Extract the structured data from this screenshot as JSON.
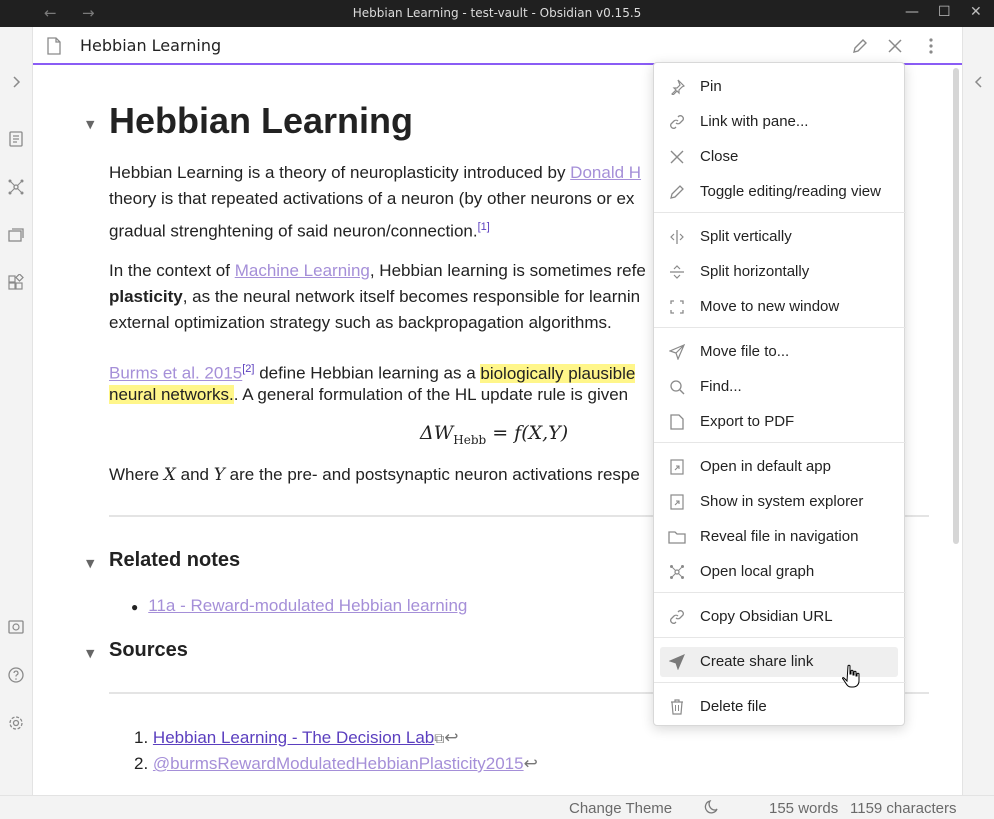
{
  "window": {
    "title": "Hebbian Learning - test-vault - Obsidian v0.15.5",
    "back": "←",
    "forward": "→",
    "minimize": "—",
    "maximize": "☐",
    "close": "✕"
  },
  "pane": {
    "title": "Hebbian Learning"
  },
  "note": {
    "h1": "Hebbian Learning",
    "p1": {
      "l1_before": "Hebbian Learning is a theory of neuroplasticity introduced by ",
      "l1_link": "Donald H",
      "l2": "theory is that repeated activations of a neuron (by other neurons or ex",
      "l3": "gradual strenghtening of said neuron/connection.",
      "l3_sup": "[1]"
    },
    "p2": {
      "l1_before": "In the context of ",
      "l1_link": "Machine Learning",
      "l1_after": ", Hebbian learning is sometimes refe",
      "l2_bold": "plasticity",
      "l2_after": ", as the neural network itself becomes responsible for learnin",
      "l3": "external optimization strategy such as backpropagation algorithms."
    },
    "p3": {
      "l1_link": "Burms et al. 2015",
      "l1_sup": "[2]",
      "l1_middle": " define Hebbian learning as a ",
      "l1_hl": "biologically plausible",
      "l2_hl": "neural networks.",
      "l2_after": ". A general formulation of the HL update rule is given"
    },
    "formula": {
      "delta_w": "ΔW",
      "sub": "Hebb",
      "rest": " = f(X,Y)"
    },
    "p4": {
      "before": "Where ",
      "x": "X",
      "mid": " and ",
      "y": "Y",
      "after": " are the pre- and postsynaptic neuron activations respe"
    },
    "related_heading": "Related notes",
    "related_items": [
      "11a - Reward-modulated Hebbian learning"
    ],
    "sources_heading": "Sources",
    "sources": [
      {
        "num": "1.",
        "label": "Hebbian Learning - The Decision Lab",
        "ext": "⧉",
        "back": "↩"
      },
      {
        "num": "2.",
        "label": "@burmsRewardModulatedHebbianPlasticity2015",
        "back": "↩"
      }
    ]
  },
  "menu": {
    "items": [
      {
        "label": "Pin",
        "icon": "pin-icon"
      },
      {
        "label": "Link with pane...",
        "icon": "link-icon"
      },
      {
        "label": "Close",
        "icon": "close-icon"
      },
      {
        "label": "Toggle editing/reading view",
        "icon": "pencil-icon"
      },
      {
        "label": "Split vertically",
        "icon": "split-vertical-icon"
      },
      {
        "label": "Split horizontally",
        "icon": "split-horizontal-icon"
      },
      {
        "label": "Move to new window",
        "icon": "new-window-icon"
      },
      {
        "label": "Move file to...",
        "icon": "paper-plane-icon"
      },
      {
        "label": "Find...",
        "icon": "search-icon"
      },
      {
        "label": "Export to PDF",
        "icon": "document-icon"
      },
      {
        "label": "Open in default app",
        "icon": "external-app-icon"
      },
      {
        "label": "Show in system explorer",
        "icon": "external-app-icon"
      },
      {
        "label": "Reveal file in navigation",
        "icon": "folder-icon"
      },
      {
        "label": "Open local graph",
        "icon": "graph-icon"
      },
      {
        "label": "Copy Obsidian URL",
        "icon": "link-icon"
      },
      {
        "label": "Create share link",
        "icon": "paper-plane-icon"
      },
      {
        "label": "Delete file",
        "icon": "trash-icon"
      }
    ]
  },
  "status": {
    "change_theme": "Change Theme",
    "theme_icon": "moon-icon",
    "words": "155 words",
    "characters": "1159 characters"
  },
  "colors": {
    "accent": "#8a5cf5",
    "link": "#a58fd8",
    "highlight": "#fff68a"
  }
}
